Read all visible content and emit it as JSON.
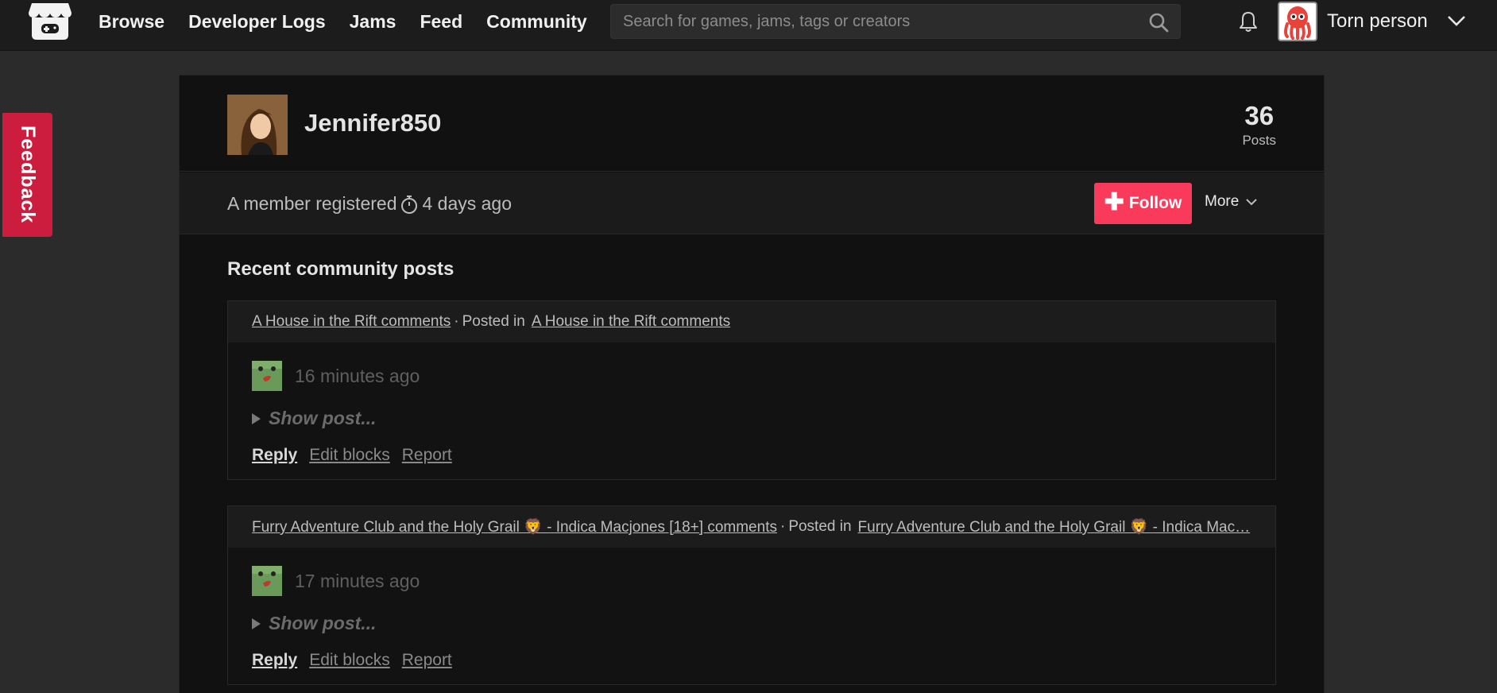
{
  "nav": {
    "items": [
      "Browse",
      "Developer Logs",
      "Jams",
      "Feed",
      "Community"
    ],
    "search_placeholder": "Search for games, jams, tags or creators",
    "user_name": "Torn person"
  },
  "feedback_label": "Feedback",
  "profile": {
    "username": "Jennifer850",
    "posts_count": "36",
    "posts_label": "Posts",
    "member_prefix": "A member registered",
    "member_age": "4 days ago",
    "follow_label": "Follow",
    "more_label": "More"
  },
  "section_title": "Recent community posts",
  "posts": [
    {
      "topic": "A House in the Rift comments",
      "posted_in_label": "Posted in",
      "board": "A House in the Rift comments",
      "time": "16 minutes ago",
      "show_post": "Show post...",
      "reply": "Reply",
      "edit": "Edit blocks",
      "report": "Report"
    },
    {
      "topic": "Furry Adventure Club and the Holy Grail 🦁 - Indica Macjones [18+] comments",
      "posted_in_label": "Posted in",
      "board": "Furry Adventure Club and the Holy Grail 🦁 - Indica Mac…",
      "time": "17 minutes ago",
      "show_post": "Show post...",
      "reply": "Reply",
      "edit": "Edit blocks",
      "report": "Report"
    }
  ],
  "colors": {
    "accent": "#fa3a5a",
    "feedback": "#cc1d3f",
    "panel": "#111111",
    "topbar": "#1c1c1c"
  }
}
